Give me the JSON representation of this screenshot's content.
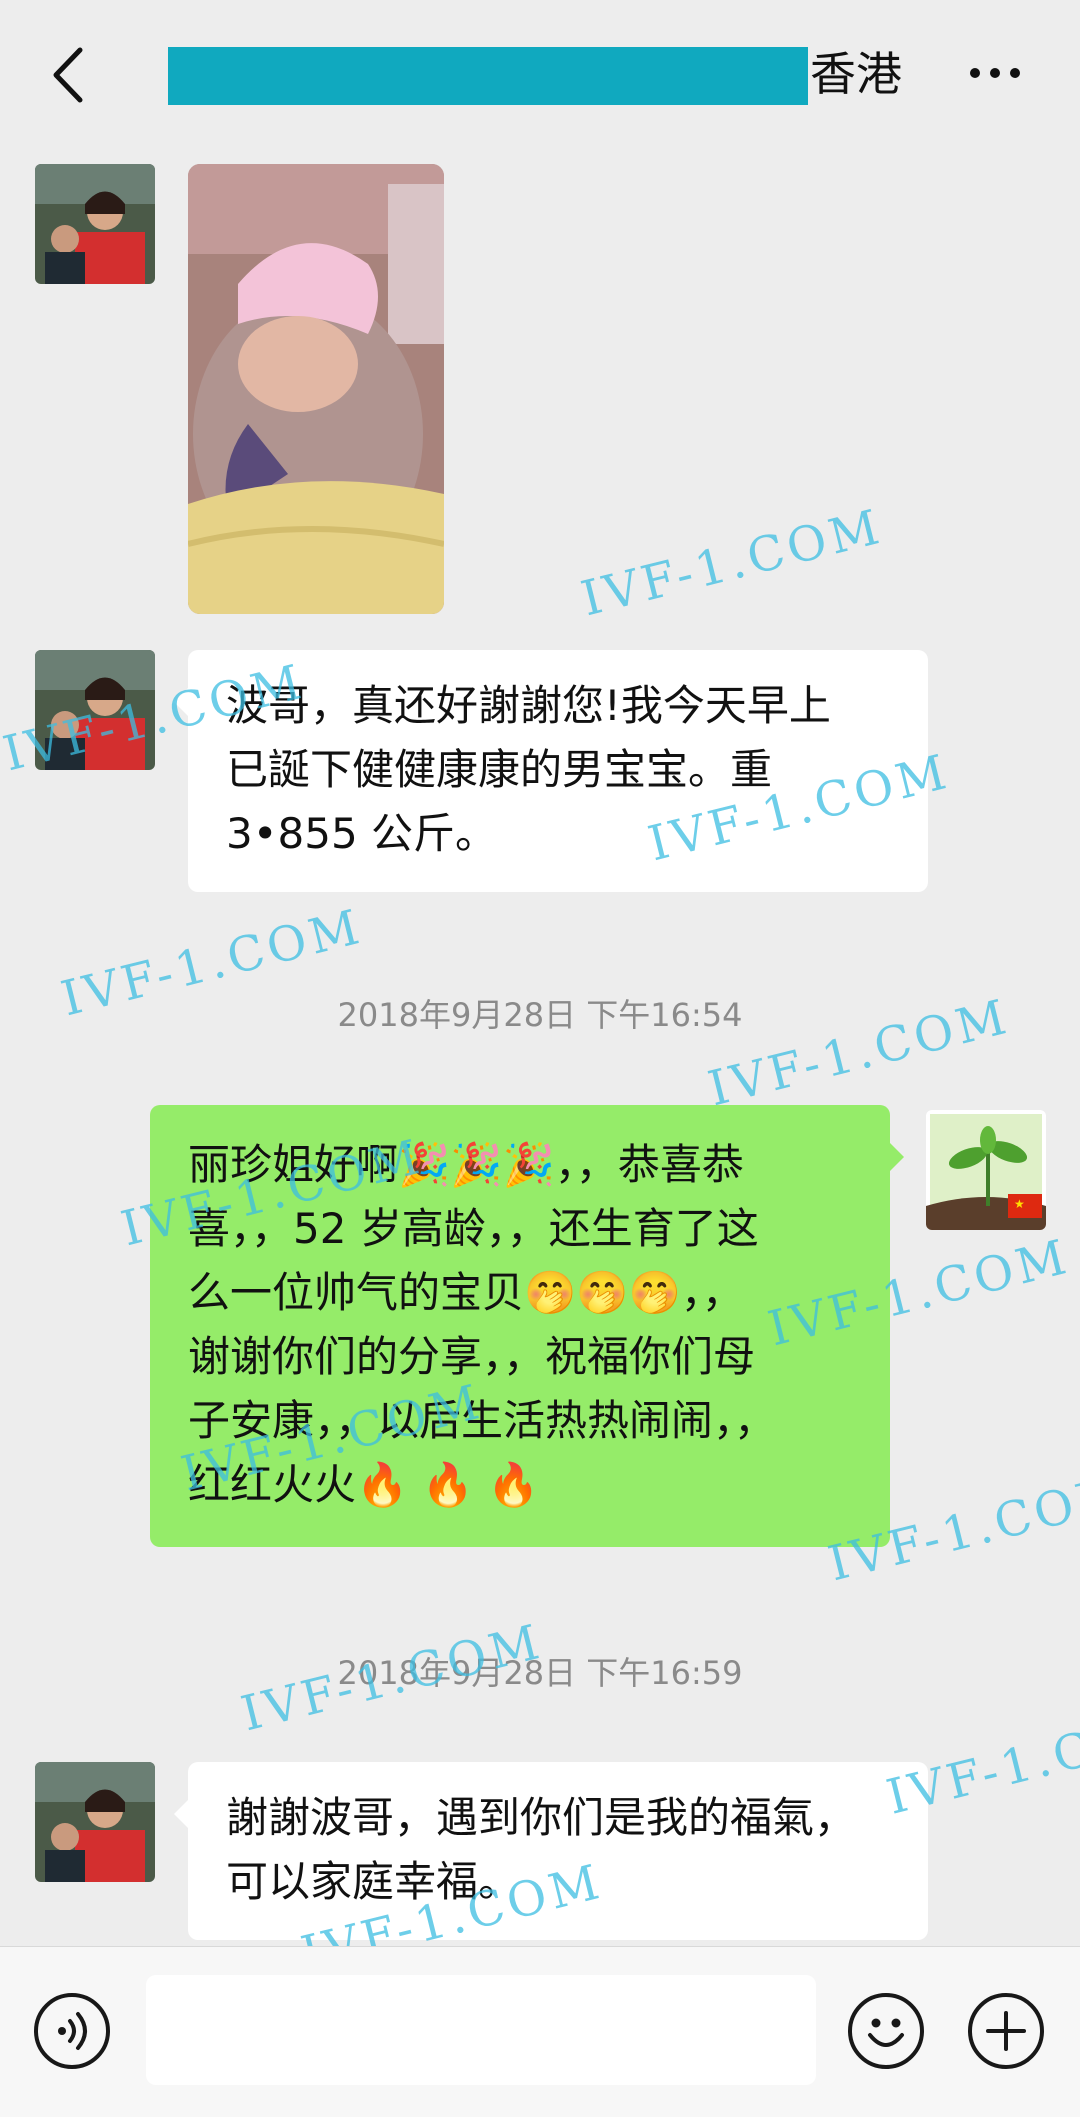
{
  "header": {
    "title": "香港",
    "back_icon": "chevron-left-icon",
    "more_icon": "more-dots-icon"
  },
  "messages": {
    "m2_text": "波哥，真还好謝謝您!我今天早上\n已誕下健健康康的男宝宝。重\n3•855 公斤。",
    "ts1": "2018年9月28日 下午16:54",
    "m3_text": "丽珍姐好啊🎉🎉🎉，，恭喜恭\n喜，，52 岁高龄，，还生育了这\n么一位帅气的宝贝🤭🤭🤭，，\n谢谢你们的分享，，祝福你们母\n子安康，，以后生活热热闹闹，，\n红红火火🔥 🔥 🔥",
    "ts2": "2018年9月28日 下午16:59",
    "m4_text": "謝謝波哥，遇到你们是我的福氣，\n可以家庭幸福。"
  },
  "watermarks": {
    "text": "IVF-1.COM",
    "partial": "IVF-1.C"
  },
  "composer": {
    "voice_icon": "voice-icon",
    "emoji_icon": "emoji-icon",
    "plus_icon": "plus-icon",
    "input_value": ""
  },
  "colors": {
    "title_mask": "#10a9bf",
    "sent_bubble": "#95ec69",
    "received_bubble": "#ffffff",
    "watermark": "#3cbee1"
  }
}
